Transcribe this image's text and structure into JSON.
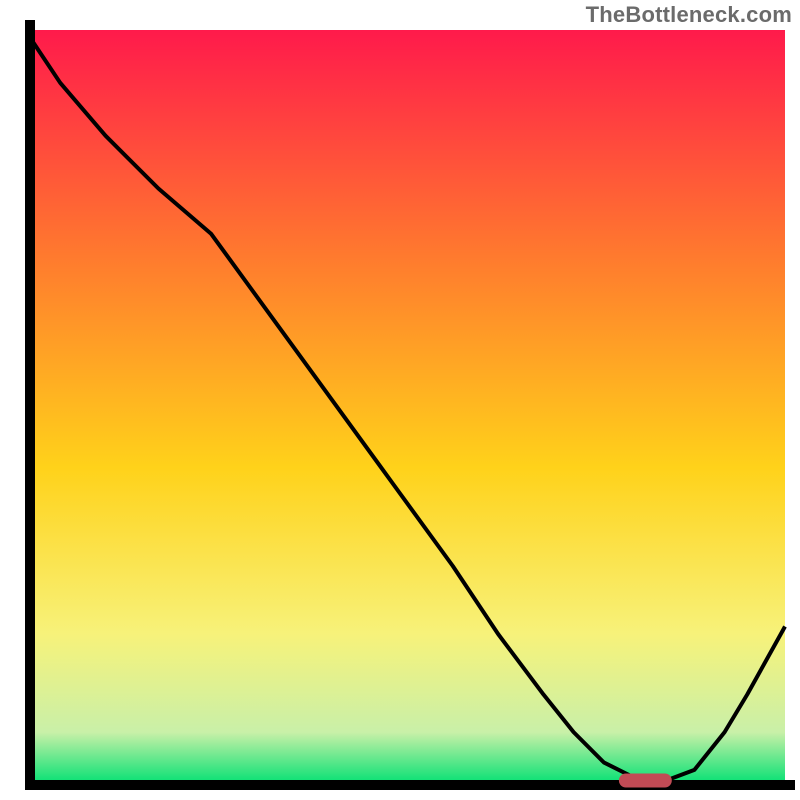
{
  "attribution": "TheBottleneck.com",
  "colors": {
    "gradient_top": "#ff1a4b",
    "gradient_mid1": "#ff7a2e",
    "gradient_mid2": "#ffd21a",
    "gradient_low1": "#f7f27a",
    "gradient_low2": "#c9f0a8",
    "gradient_bottom": "#00e072",
    "axis": "#000000",
    "curve": "#000000",
    "marker": "#c14b55"
  },
  "chart_data": {
    "type": "line",
    "title": "",
    "xlabel": "",
    "ylabel": "",
    "xlim": [
      0,
      100
    ],
    "ylim": [
      0,
      100
    ],
    "x": [
      0,
      4,
      10,
      17,
      24,
      32,
      40,
      48,
      56,
      62,
      68,
      72,
      76,
      80,
      82,
      84,
      88,
      92,
      95,
      100
    ],
    "values": [
      99,
      93,
      86,
      79,
      73,
      62,
      51,
      40,
      29,
      20,
      12,
      7,
      3,
      1,
      0.5,
      0.5,
      2,
      7,
      12,
      21
    ],
    "marker": {
      "x_start": 78,
      "x_end": 85,
      "y": 0.6
    }
  }
}
